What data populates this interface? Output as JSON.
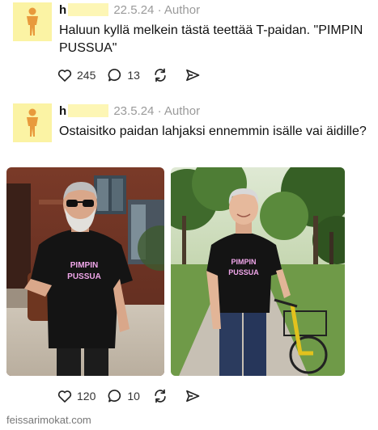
{
  "posts": [
    {
      "user": "h",
      "date": "22.5.24",
      "separator": "·",
      "role": "Author",
      "text": "Haluun kyllä melkein tästä teettää T-paidan. \"PIMPIN PUSSUA\"",
      "likes": "245",
      "comments": "13"
    },
    {
      "user": "h",
      "date": "23.5.24",
      "separator": "·",
      "role": "Author",
      "text": "Ostaisitko paidan lahjaksi ennemmin isälle vai äidille?",
      "likes": "120",
      "comments": "10",
      "shirt_text_line1": "PIMPIN",
      "shirt_text_line2": "PUSSUA"
    }
  ],
  "watermark": "feissarimokat.com",
  "colors": {
    "avatar_bg": "#fbf3a4",
    "avatar_figure": "#e89a3c",
    "redaction": "#fdf6b5",
    "muted_text": "#9a9a9a",
    "shirt_print": "#f0a6ea"
  },
  "icons": [
    "person-icon",
    "heart-icon",
    "comment-icon",
    "repost-icon",
    "share-icon"
  ]
}
